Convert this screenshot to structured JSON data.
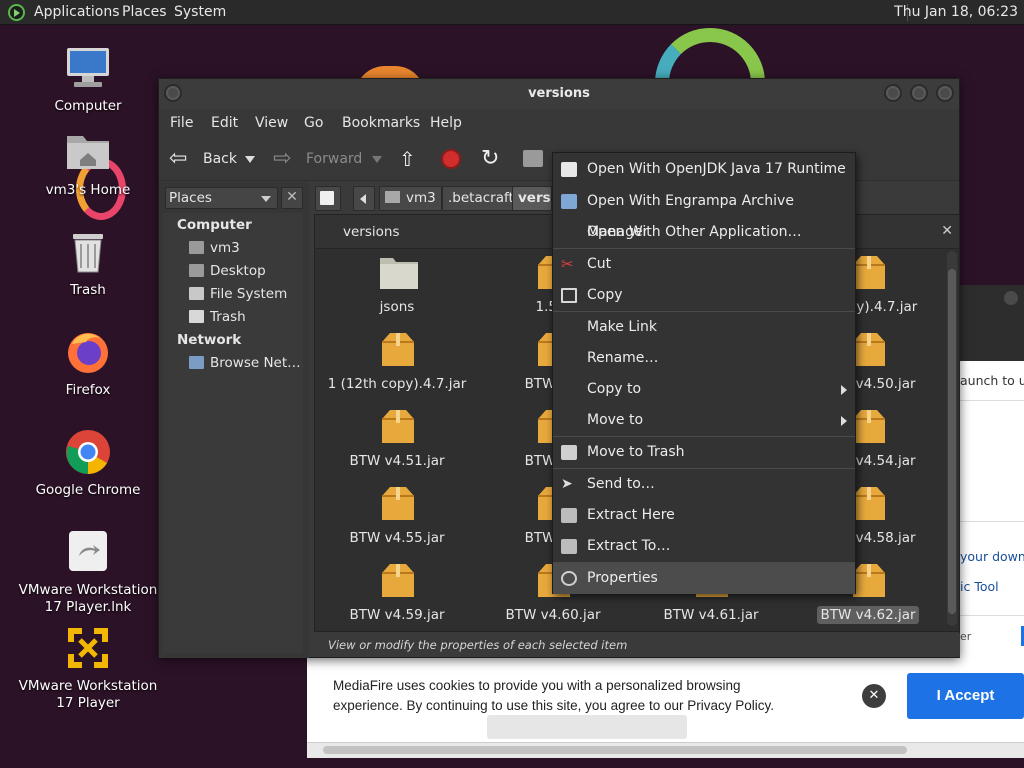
{
  "top_panel": {
    "menus": [
      "Applications",
      "Places",
      "System"
    ],
    "clock": "Thu Jan 18, 06:23"
  },
  "desktop": {
    "icons": [
      {
        "label": "Computer",
        "icon": "computer-icon"
      },
      {
        "label": "vm3's Home",
        "icon": "home-folder-icon"
      },
      {
        "label": "Trash",
        "icon": "trash-icon"
      },
      {
        "label": "Firefox",
        "icon": "firefox-icon"
      },
      {
        "label": "Google Chrome",
        "icon": "chrome-icon"
      },
      {
        "label": "VMware Workstation 17 Player.lnk",
        "icon": "shortcut-icon"
      },
      {
        "label": "VMware Workstation 17 Player",
        "icon": "vmware-icon"
      }
    ]
  },
  "file_manager": {
    "title": "versions",
    "menubar": [
      "File",
      "Edit",
      "View",
      "Go",
      "Bookmarks",
      "Help"
    ],
    "toolbar": {
      "back": "Back",
      "forward": "Forward"
    },
    "sidebar": {
      "selector": "Places",
      "sections": [
        {
          "heading": "Computer",
          "items": [
            "vm3",
            "Desktop",
            "File System",
            "Trash"
          ]
        },
        {
          "heading": "Network",
          "items": [
            "Browse Net…"
          ]
        }
      ]
    },
    "path": [
      "vm3",
      ".betacraft",
      "versio"
    ],
    "location_header": "versions",
    "files": [
      [
        "jsons",
        "1.5…",
        "",
        "…copy).4.7.jar"
      ],
      [
        "1 (12th copy).4.7.jar",
        "BTW v…",
        "",
        "BTW v4.50.jar"
      ],
      [
        "BTW v4.51.jar",
        "BTW v…",
        "",
        "BTW v4.54.jar"
      ],
      [
        "BTW v4.55.jar",
        "BTW v…",
        "",
        "BTW v4.58.jar"
      ],
      [
        "BTW v4.59.jar",
        "BTW v4.60.jar",
        "BTW v4.61.jar",
        "BTW v4.62.jar"
      ]
    ],
    "status": "View or modify the properties of each selected item"
  },
  "context_menu": {
    "items": [
      "Open With OpenJDK Java 17 Runtime",
      "Open With Engrampa Archive Manager",
      "Open With Other Application…",
      "Cut",
      "Copy",
      "Make Link",
      "Rename…",
      "Copy to",
      "Move to",
      "Move to Trash",
      "Send to…",
      "Extract Here",
      "Extract To…",
      "Properties"
    ],
    "highlighted": "Properties"
  },
  "browser_background": {
    "cookie_text": "MediaFire uses cookies to provide you with a personalized browsing experience. By continuing to use this site, you agree to our Privacy Policy.",
    "accept_label": "I Accept",
    "snippets": [
      "aunch to up",
      "your downlo",
      "ic Tool",
      "er"
    ]
  },
  "colors": {
    "accent": "#1d73e6",
    "panel": "#2a2a2a",
    "window": "#3a3a3a",
    "desktop": "#2c1227",
    "archive": "#e8a93c"
  }
}
